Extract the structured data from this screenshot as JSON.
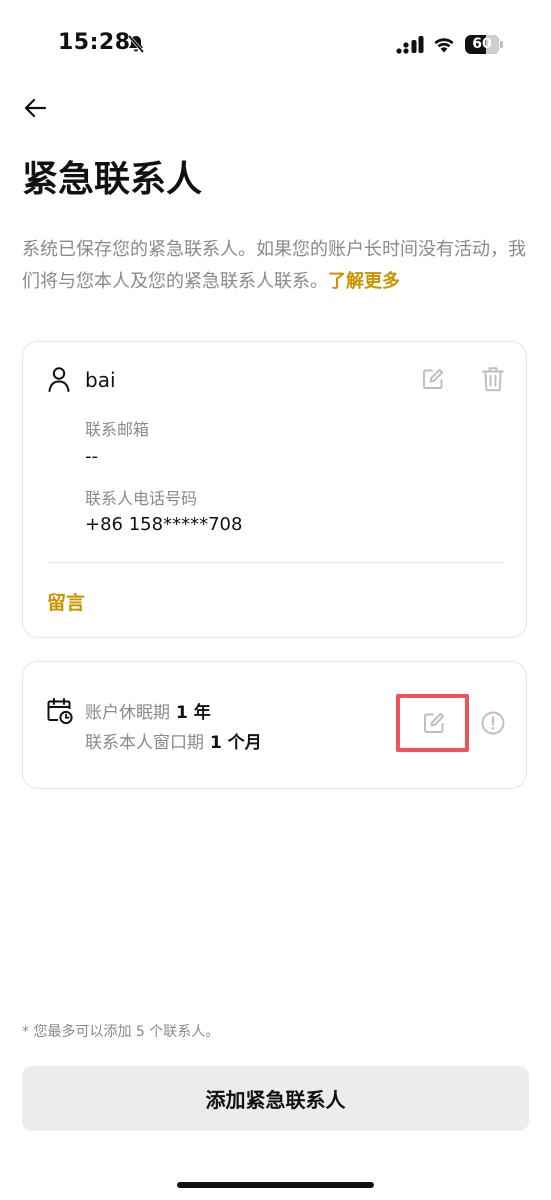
{
  "status_bar": {
    "time": "15:28",
    "battery": "60",
    "icons": [
      "bell-slash-icon",
      "signal-icon",
      "wifi-icon",
      "battery-icon"
    ]
  },
  "header": {
    "back_icon": "arrow-left-icon",
    "title": "紧急联系人"
  },
  "description": {
    "text": "系统已保存您的紧急联系人。如果您的账户长时间没有活动，我们将与您本人及您的紧急联系人联系。",
    "link": "了解更多"
  },
  "contact": {
    "name": "bai",
    "email_label": "联系邮箱",
    "email_value": "--",
    "phone_label": "联系人电话号码",
    "phone_value": "+86 158*****708",
    "message_link": "留言",
    "icons": [
      "person-icon",
      "edit-icon",
      "trash-icon"
    ]
  },
  "settings": {
    "dormancy_label": "账户休眠期",
    "dormancy_value": "1 年",
    "window_label": "联系本人窗口期",
    "window_value": "1 个月",
    "icons": [
      "calendar-clock-icon",
      "edit-icon",
      "info-icon"
    ]
  },
  "footer": {
    "note": "* 您最多可以添加 5 个联系人。",
    "add_button": "添加紧急联系人"
  },
  "colors": {
    "accent": "#c99400",
    "highlight": "#ef5456",
    "muted_text": "#8a8a8a",
    "button_bg": "#ececec"
  }
}
